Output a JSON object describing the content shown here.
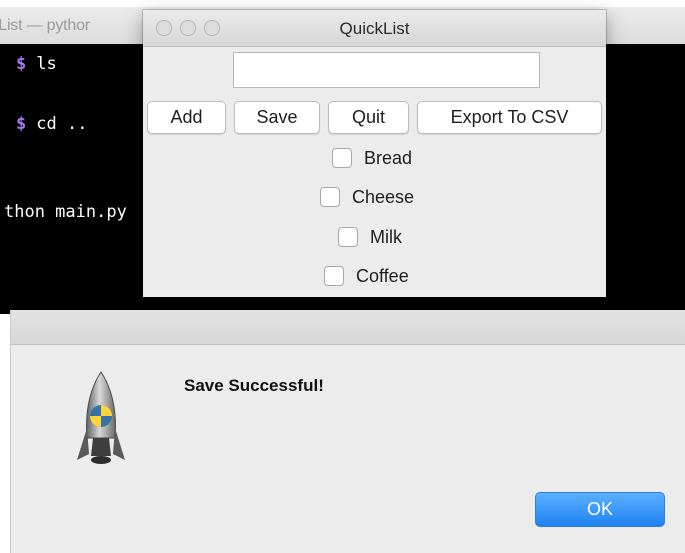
{
  "terminal": {
    "title": ":List — pythor",
    "prompt_symbol": "$",
    "lines": [
      {
        "command": "ls"
      },
      {
        "command": "cd .."
      },
      {
        "text": "thon main.py"
      }
    ]
  },
  "app": {
    "title": "QuickList",
    "entry": {
      "value": "",
      "placeholder": ""
    },
    "buttons": {
      "add": "Add",
      "save": "Save",
      "quit": "Quit",
      "export": "Export To CSV"
    },
    "items": [
      {
        "label": "Bread",
        "checked": false
      },
      {
        "label": "Cheese",
        "checked": false
      },
      {
        "label": "Milk",
        "checked": false
      },
      {
        "label": "Coffee",
        "checked": false
      }
    ]
  },
  "dialog": {
    "message": "Save Successful!",
    "ok_label": "OK",
    "icon": "python-rocket-icon"
  },
  "colors": {
    "prompt": "#a678f0",
    "ok_button": "#1f82f2",
    "terminal_bg": "#000000"
  }
}
